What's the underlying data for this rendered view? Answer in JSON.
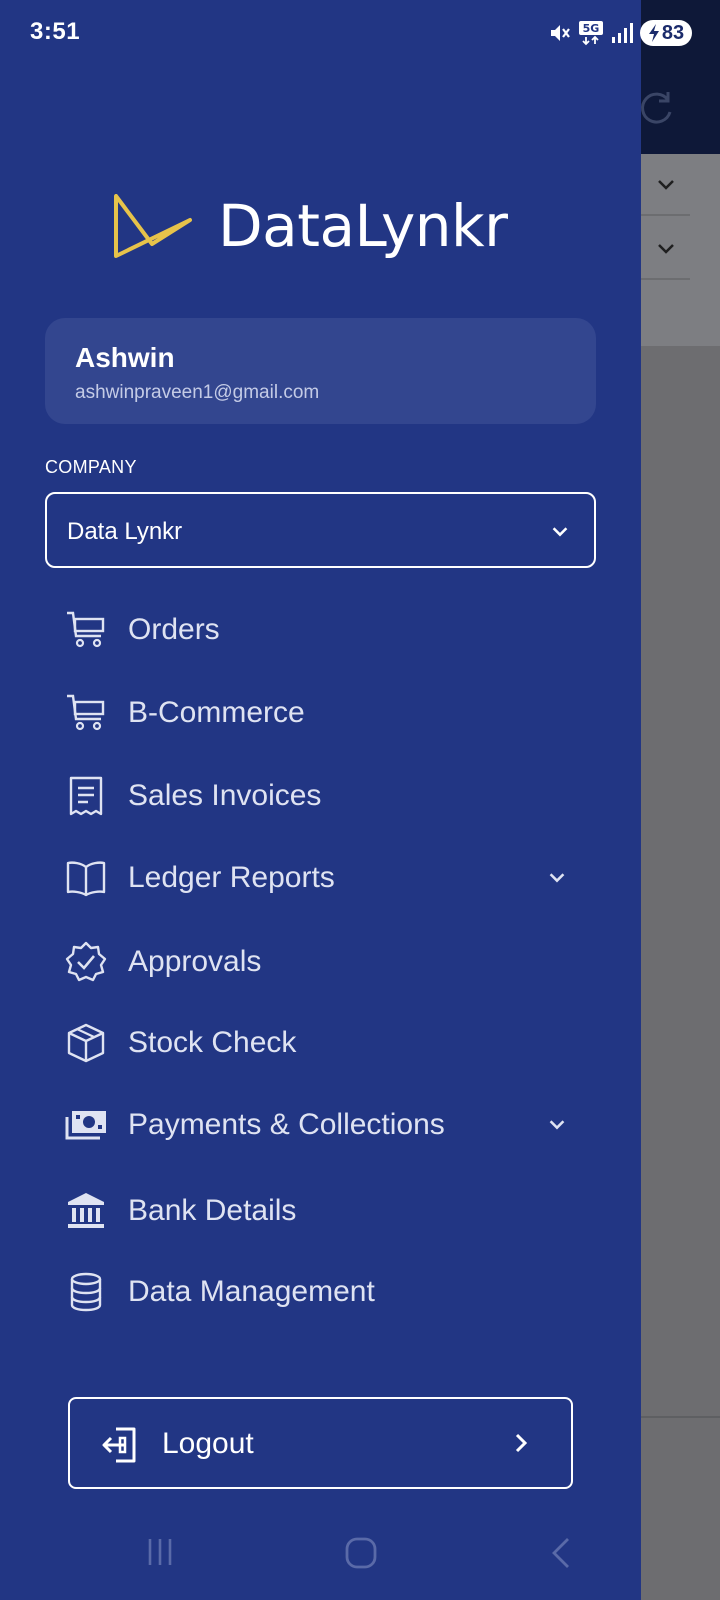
{
  "status_bar": {
    "time": "3:51",
    "network": "5G",
    "battery": "83"
  },
  "brand": {
    "name": "DataLynkr",
    "accent_color": "#e7c34a",
    "drawer_color": "#223684"
  },
  "user": {
    "name": "Ashwin",
    "email": "ashwinpraveen1@gmail.com"
  },
  "company": {
    "label": "COMPANY",
    "selected": "Data Lynkr"
  },
  "menu": {
    "items": [
      {
        "label": "Orders",
        "icon": "cart-icon"
      },
      {
        "label": "B-Commerce",
        "icon": "cart-icon"
      },
      {
        "label": "Sales Invoices",
        "icon": "receipt-icon"
      },
      {
        "label": "Ledger Reports",
        "icon": "book-icon"
      },
      {
        "label": "Approvals",
        "icon": "badge-check-icon"
      },
      {
        "label": "Stock Check",
        "icon": "box-icon"
      },
      {
        "label": "Payments & Collections",
        "icon": "cash-icon"
      },
      {
        "label": "Bank Details",
        "icon": "bank-icon"
      },
      {
        "label": "Data Management",
        "icon": "database-icon"
      }
    ]
  },
  "logout": {
    "label": "Logout"
  }
}
